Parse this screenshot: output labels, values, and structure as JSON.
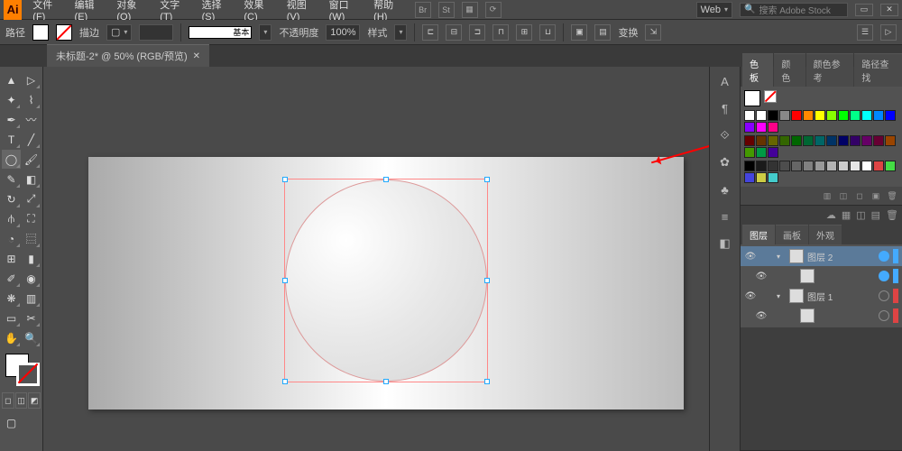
{
  "app": {
    "logo_text": "Ai"
  },
  "menu": {
    "items": [
      "文件(F)",
      "编辑(E)",
      "对象(O)",
      "文字(T)",
      "选择(S)",
      "效果(C)",
      "视图(V)",
      "窗口(W)",
      "帮助(H)"
    ]
  },
  "menubar_right": {
    "btn_br": "Br",
    "btn_st": "St",
    "workspace_label": "Web",
    "search_placeholder": "搜索 Adobe Stock"
  },
  "controlbar": {
    "label_path": "路径",
    "label_stroke": "描边",
    "stroke_style_label": "基本",
    "label_opacity": "不透明度",
    "opacity_value": "100%",
    "label_style": "样式",
    "label_transform": "变换"
  },
  "document": {
    "tab_title": "未标题-2* @ 50% (RGB/预览)"
  },
  "panels": {
    "swatches": {
      "tabs": [
        "色板",
        "颜色",
        "颜色参考",
        "路径查找"
      ],
      "row1": [
        "#ffffff",
        "#ffffff",
        "#000000",
        "#888888",
        "#ff0000",
        "#ff8800",
        "#ffff00",
        "#88ff00",
        "#00ff00",
        "#00ff88",
        "#00ffff",
        "#0088ff",
        "#0000ff",
        "#8800ff",
        "#ff00ff",
        "#ff0088"
      ],
      "row2": [
        "#660000",
        "#663300",
        "#666600",
        "#336600",
        "#006600",
        "#006633",
        "#006666",
        "#003366",
        "#000066",
        "#330066",
        "#660066",
        "#660033",
        "#994400",
        "#449900",
        "#009944",
        "#440099"
      ],
      "row3_grays": [
        "#000000",
        "#1a1a1a",
        "#333333",
        "#4d4d4d",
        "#666666",
        "#808080",
        "#999999",
        "#b3b3b3",
        "#cccccc",
        "#e6e6e6",
        "#ffffff"
      ],
      "row3_extra": [
        "#d44",
        "#4d4",
        "#44d",
        "#cc4",
        "#4cc"
      ]
    },
    "layers": {
      "tabs": [
        "图层",
        "画板",
        "外观"
      ],
      "items": [
        {
          "name": "图层 2",
          "color": "#4af",
          "selected": true,
          "sub_thumb": "#ddd"
        },
        {
          "name": "图层 1",
          "color": "#d44",
          "selected": false,
          "sub_thumb": "#ccc"
        }
      ]
    }
  }
}
